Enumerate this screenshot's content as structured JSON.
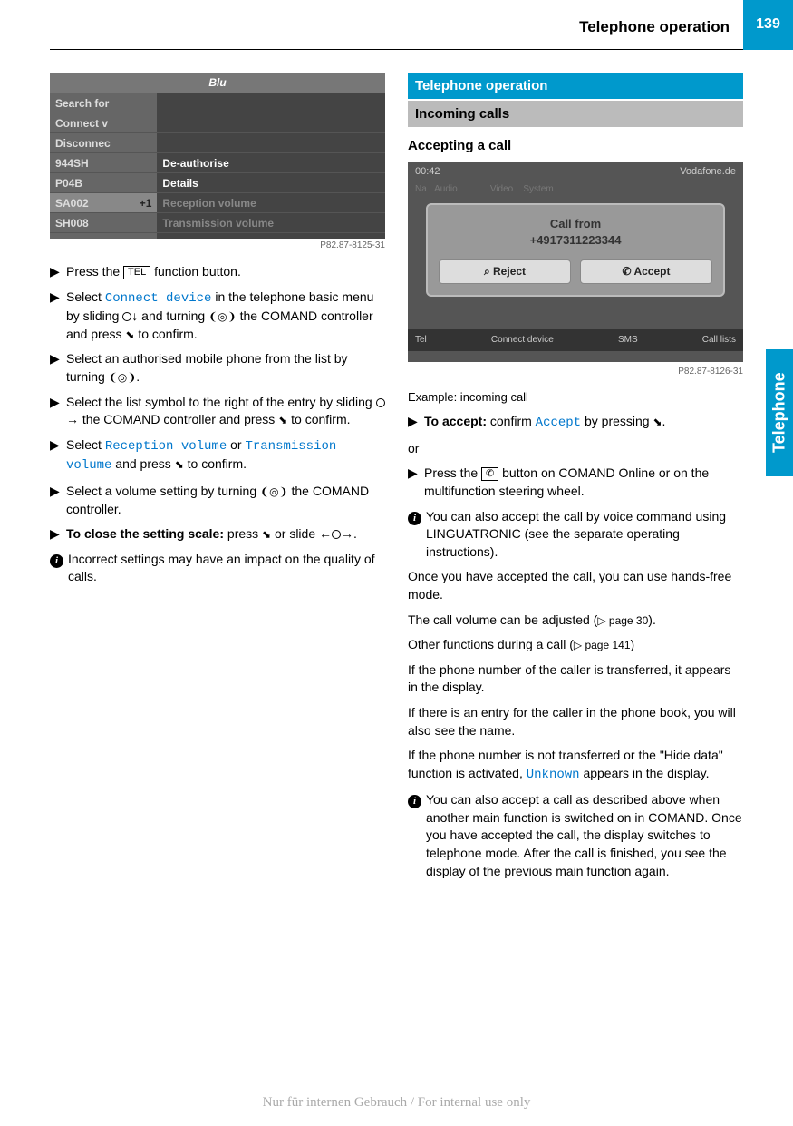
{
  "header": {
    "title": "Telephone operation",
    "pageNumber": "139"
  },
  "sideTab": "Telephone",
  "leftCol": {
    "screenshot1": {
      "top": "Blu",
      "left": [
        "Search for",
        "Connect v",
        "Disconnec",
        "944SH",
        "P04B",
        "SA002",
        "SH008"
      ],
      "badge": "+1",
      "right": [
        "",
        "",
        "",
        "De-authorise",
        "Details",
        "Reception volume",
        "Transmission volume"
      ],
      "caption": "P82.87-8125-31"
    },
    "steps": {
      "s1a": "Press the ",
      "s1btn": "TEL",
      "s1b": " function button.",
      "s2a": "Select ",
      "s2ui": "Connect device",
      "s2b": " in the telephone basic menu by sliding ",
      "s2c": " and turning ",
      "s2d": " the COMAND controller and press ",
      "s2e": " to confirm.",
      "s3a": "Select an authorised mobile phone from the list by turning ",
      "s3b": ".",
      "s4a": "Select the list symbol to the right of the entry by sliding ",
      "s4b": " the COMAND controller and press ",
      "s4c": " to confirm.",
      "s5a": "Select ",
      "s5ui1": "Reception volume",
      "s5or": " or ",
      "s5ui2": "Transmission volume",
      "s5b": " and press ",
      "s5c": " to confirm.",
      "s6a": "Select a volume setting by turning ",
      "s6b": " the COMAND controller.",
      "s7a": "To close the setting scale:",
      "s7b": " press ",
      "s7c": " or slide ",
      "s7d": "."
    },
    "info1": "Incorrect settings may have an impact on the quality of calls."
  },
  "rightCol": {
    "sectionTitle": "Telephone operation",
    "subsectionTitle": "Incoming calls",
    "heading": "Accepting a call",
    "screenshot2": {
      "time": "00:42",
      "carrier": "Vodafone.de",
      "callFrom": "Call from",
      "number": "+4917311223344",
      "reject": "Reject",
      "accept": "Accept",
      "bottom": [
        "Tel",
        "Connect device",
        "SMS",
        "Call lists"
      ],
      "caption": "P82.87-8126-31"
    },
    "exampleCaption": "Example: incoming call",
    "steps": {
      "accept_a": "To accept:",
      "accept_b": " confirm ",
      "accept_ui": "Accept",
      "accept_c": " by pressing ",
      "accept_d": ".",
      "or": "or",
      "press_a": "Press the ",
      "press_b": " button on COMAND Online or on the multifunction steering wheel."
    },
    "info2": "You can also accept the call by voice command using LINGUATRONIC (see the separate operating instructions).",
    "para1": "Once you have accepted the call, you can use hands-free mode.",
    "para2a": "The call volume can be adjusted (",
    "para2ref": "▷ page 30",
    "para2b": ").",
    "para3a": "Other functions during a call (",
    "para3ref": "▷ page 141",
    "para3b": ")",
    "para4": "If the phone number of the caller is transferred, it appears in the display.",
    "para5": "If there is an entry for the caller in the phone book, you will also see the name.",
    "para6a": "If the phone number is not transferred or the \"Hide data\" function is activated, ",
    "para6ui": "Unknown",
    "para6b": " appears in the display.",
    "info3": "You can also accept a call as described above when another main function is switched on in COMAND. Once you have accepted the call, the display switches to telephone mode. After the call is finished, you see the display of the previous main function again."
  },
  "footer": "Nur für internen Gebrauch / For internal use only"
}
